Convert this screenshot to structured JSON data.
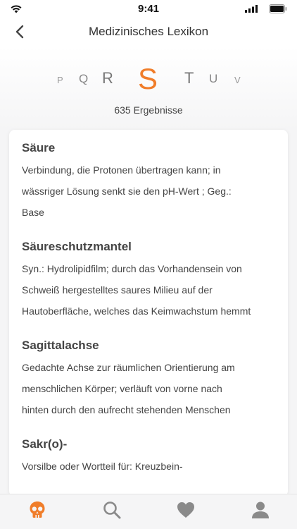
{
  "status": {
    "time": "9:41"
  },
  "nav": {
    "title": "Medizinisches Lexikon"
  },
  "alphabet": {
    "p": "P",
    "q": "Q",
    "r": "R",
    "s": "S",
    "t": "T",
    "u": "U",
    "v": "V"
  },
  "results_text": "635 Ergebnisse",
  "entries": [
    {
      "title": "Säure",
      "line1": "Verbindung, die Protonen übertragen kann; in",
      "line2": "wässriger Lösung senkt sie den  pH-Wert ; Geg.:",
      "line3": "Base"
    },
    {
      "title": "Säureschutzmantel",
      "line1": "Syn.: Hydrolipidfilm; durch das Vorhandensein von",
      "line2": "Schweiß hergestelltes saures Milieu auf der",
      "line3": "Hautoberfläche, welches das Keimwachstum hemmt"
    },
    {
      "title": "Sagittalachse",
      "line1": "Gedachte Achse zur räumlichen Orientierung am",
      "line2": "menschlichen Körper; verläuft von vorne nach",
      "line3": "hinten durch den aufrecht stehenden Menschen"
    },
    {
      "title": "Sakr(o)-",
      "line1": "Vorsilbe oder Wortteil für: Kreuzbein-"
    }
  ],
  "colors": {
    "accent": "#f07d2a",
    "icon_inactive": "#8a8a8a"
  },
  "tabs": [
    "skull-icon",
    "search-icon",
    "heart-icon",
    "user-icon"
  ]
}
